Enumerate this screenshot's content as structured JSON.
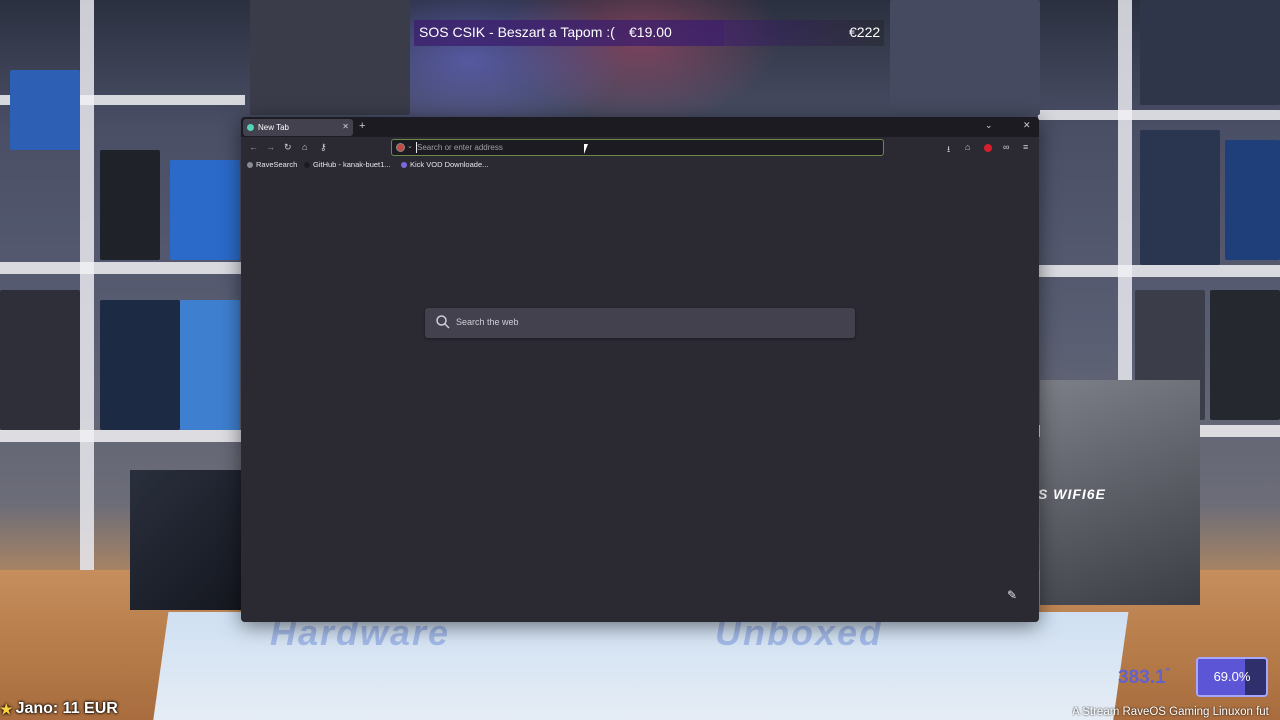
{
  "stream": {
    "alert": {
      "message": "SOS CSIK - Beszart a Tapom :(",
      "amount": "€19.00",
      "goal": "€222"
    },
    "donor": {
      "text": "Jano: 11 EUR"
    },
    "stat": {
      "value": "383.1",
      "percent_label": "69.0%",
      "percent": 69.0
    },
    "ticker": "A Stream RaveOS Gaming Linuxon fut",
    "background_labels": {
      "mat_left": "Hardware",
      "mat_right": "Unboxed",
      "box_right": "S WIFI6E"
    }
  },
  "browser": {
    "tab": {
      "title": "New Tab",
      "close_icon": "close-icon"
    },
    "newtab_icon": "plus-icon",
    "list_tabs_icon": "chevron-down-icon",
    "window_close_icon": "close-icon",
    "nav": {
      "back_icon": "arrow-left-icon",
      "forward_icon": "arrow-right-icon",
      "reload_icon": "reload-icon",
      "home_icon": "home-icon",
      "key_icon": "key-icon"
    },
    "urlbar": {
      "placeholder": "Search or enter address",
      "value": ""
    },
    "toolbar": {
      "download_icon": "download-icon",
      "extension_icon": "puzzle-icon",
      "ublock_icon": "shield-icon",
      "vpn_icon": "glasses-icon",
      "menu_icon": "hamburger-icon"
    },
    "bookmarks": [
      {
        "label": "RaveSearch",
        "icon_color": "#8a8a96"
      },
      {
        "label": "GitHub - kanak-buet1...",
        "icon_color": "#1c1b22"
      },
      {
        "label": "Kick VOD Downloade...",
        "icon_color": "#7a6ae0"
      }
    ],
    "newtab_page": {
      "search_placeholder": "Search the web",
      "edit_icon": "pencil-icon"
    }
  }
}
